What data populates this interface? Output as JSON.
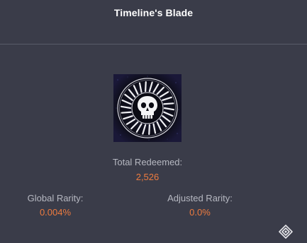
{
  "title": "Timeline's Blade",
  "stats": {
    "total_redeemed_label": "Total Redeemed:",
    "total_redeemed_value": "2,526",
    "global_rarity_label": "Global Rarity:",
    "global_rarity_value": "0.004%",
    "adjusted_rarity_label": "Adjusted Rarity:",
    "adjusted_rarity_value": "0.0%"
  },
  "icons": {
    "emblem": "skull-emblem-icon",
    "corner": "destiny-tracker-logo-icon"
  },
  "colors": {
    "background": "#3a3c49",
    "accent": "#ee7b3f",
    "label": "#b6b8c1",
    "title": "#ffffff"
  }
}
